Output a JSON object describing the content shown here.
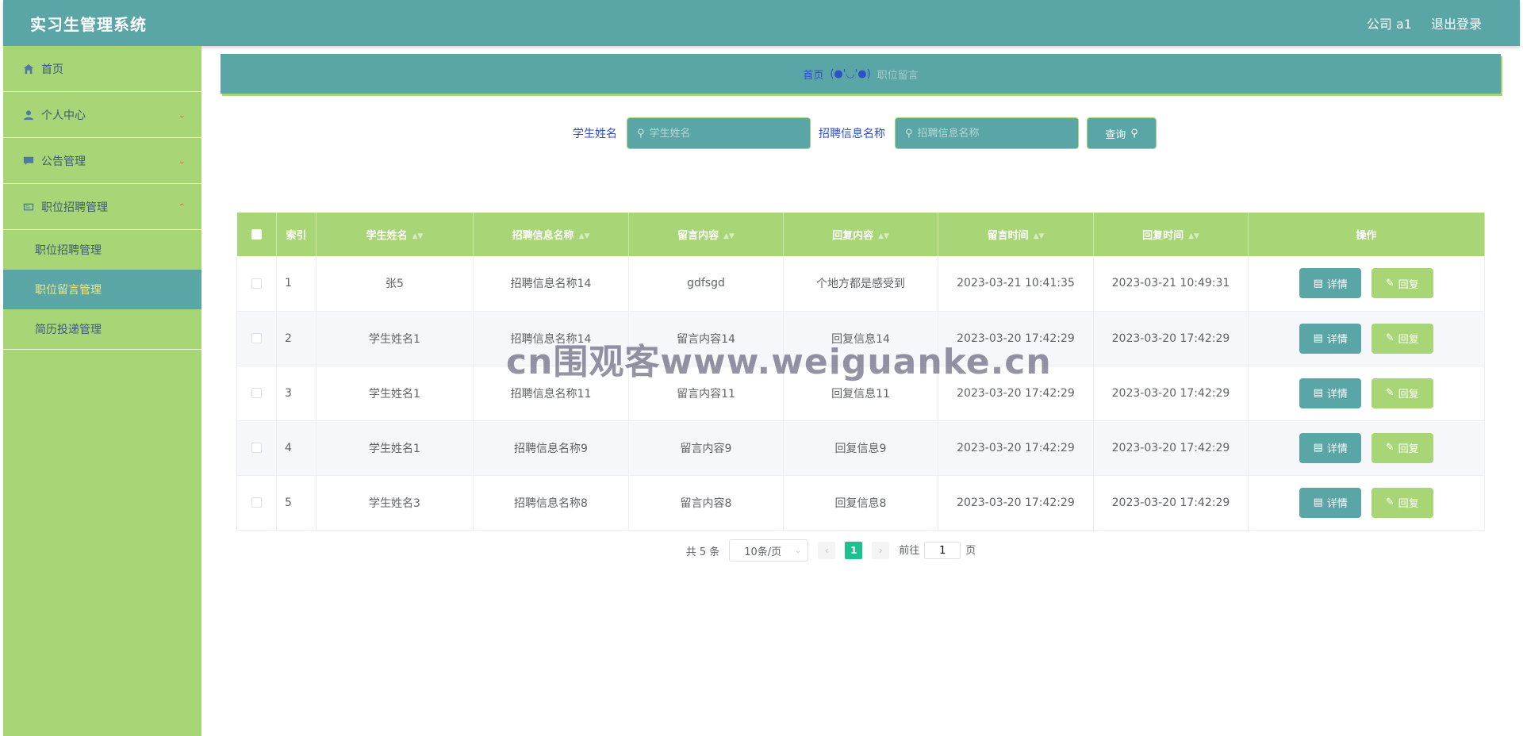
{
  "header": {
    "title": "实习生管理系统",
    "user": "公司 a1",
    "logout": "退出登录"
  },
  "sidebar": {
    "items": [
      {
        "label": "首页",
        "icon": "home-icon"
      },
      {
        "label": "个人中心",
        "icon": "user-icon"
      },
      {
        "label": "公告管理",
        "icon": "message-icon"
      },
      {
        "label": "职位招聘管理",
        "icon": "postcard-icon"
      }
    ],
    "submenu": [
      "职位招聘管理",
      "职位留言管理",
      "简历投递管理"
    ]
  },
  "breadcrumb": {
    "home": "首页",
    "separator": "(●'◡'●)",
    "current": "职位留言"
  },
  "search": {
    "student_label": "学生姓名",
    "student_placeholder": "学生姓名",
    "job_label": "招聘信息名称",
    "job_placeholder": "招聘信息名称",
    "query_button": "查询"
  },
  "table": {
    "headers": [
      "索引",
      "学生姓名",
      "招聘信息名称",
      "留言内容",
      "回复内容",
      "留言时间",
      "回复时间",
      "操作"
    ],
    "rows": [
      {
        "index": "1",
        "student": "张5",
        "job": "招聘信息名称14",
        "message": "gdfsgd",
        "reply": "个地方都是感受到",
        "msg_time": "2023-03-21 10:41:35",
        "reply_time": "2023-03-21 10:49:31"
      },
      {
        "index": "2",
        "student": "学生姓名1",
        "job": "招聘信息名称14",
        "message": "留言内容14",
        "reply": "回复信息14",
        "msg_time": "2023-03-20 17:42:29",
        "reply_time": "2023-03-20 17:42:29"
      },
      {
        "index": "3",
        "student": "学生姓名1",
        "job": "招聘信息名称11",
        "message": "留言内容11",
        "reply": "回复信息11",
        "msg_time": "2023-03-20 17:42:29",
        "reply_time": "2023-03-20 17:42:29"
      },
      {
        "index": "4",
        "student": "学生姓名1",
        "job": "招聘信息名称9",
        "message": "留言内容9",
        "reply": "回复信息9",
        "msg_time": "2023-03-20 17:42:29",
        "reply_time": "2023-03-20 17:42:29"
      },
      {
        "index": "5",
        "student": "学生姓名3",
        "job": "招聘信息名称8",
        "message": "留言内容8",
        "reply": "回复信息8",
        "msg_time": "2023-03-20 17:42:29",
        "reply_time": "2023-03-20 17:42:29"
      }
    ],
    "detail_label": "详情",
    "reply_label": "回复"
  },
  "pagination": {
    "total": "共 5 条",
    "page_size": "10条/页",
    "current": "1",
    "goto_prefix": "前往",
    "goto_value": "1",
    "goto_suffix": "页"
  },
  "watermark": "cn围观客www.weiguanke.cn",
  "colors": {
    "teal": "#5aa6a6",
    "green": "#a8d677",
    "active_text": "#f3e77a",
    "page_active": "#1fbf8f"
  }
}
